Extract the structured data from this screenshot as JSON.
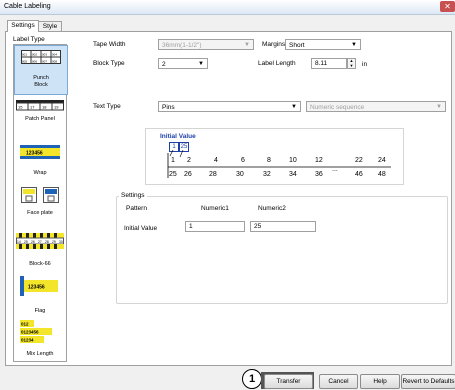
{
  "window": {
    "title": "Cable Labeling"
  },
  "tabs": [
    {
      "label": "Settings"
    },
    {
      "label": "Style"
    }
  ],
  "sidebar": {
    "title": "Label Type",
    "items": [
      {
        "label": "Punch Block",
        "icon": "punch-block-icon",
        "selected": true
      },
      {
        "label": "Patch Panel",
        "icon": "patch-panel-icon"
      },
      {
        "label": "Wrap",
        "icon": "wrap-icon"
      },
      {
        "label": "Face plate",
        "icon": "face-plate-icon"
      },
      {
        "label": "Block-66",
        "icon": "block-66-icon"
      },
      {
        "label": "Flag",
        "icon": "flag-icon"
      },
      {
        "label": "Mix Length",
        "icon": "mix-length-icon"
      }
    ],
    "icon_texts": {
      "punch": [
        "001",
        "002",
        "003",
        "004",
        "005",
        "006",
        "007",
        "008"
      ],
      "patch": [
        "15",
        "17",
        "18",
        "19"
      ],
      "wrap": "123456",
      "block66": [
        "14",
        "25",
        "26",
        "27",
        "28",
        "29",
        "30"
      ],
      "flag": "123456",
      "mix": [
        "012",
        "0123456",
        "01234"
      ]
    }
  },
  "form": {
    "tape_width": {
      "label": "Tape Width",
      "value": "36mm(1-1/2\")"
    },
    "margins": {
      "label": "Margins",
      "value": "Short"
    },
    "block_type": {
      "label": "Block Type",
      "value": "2"
    },
    "label_length": {
      "label": "Label Length",
      "value": "8.11",
      "unit": "in"
    },
    "text_type": {
      "label": "Text Type",
      "value": "Pins",
      "secondary": "Numeric sequence"
    }
  },
  "diagram": {
    "title": "Initial Value",
    "boxes": [
      "1",
      "25"
    ],
    "top_row": [
      "1",
      "2",
      "4",
      "6",
      "8",
      "10",
      "12",
      "22",
      "24"
    ],
    "bottom_row": [
      "25",
      "26",
      "28",
      "30",
      "32",
      "34",
      "36",
      "46",
      "48"
    ],
    "ellipsis": "..."
  },
  "settings_group": {
    "title": "Settings",
    "col_pattern": "Pattern",
    "col1": "Numeric1",
    "col2": "Numeric2",
    "row_label": "Initial Value",
    "value1": "1",
    "value2": "25"
  },
  "buttons": {
    "marker": "1",
    "transfer": "Transfer",
    "cancel": "Cancel",
    "help": "Help",
    "revert": "Revert to Defaults"
  },
  "colors": {
    "accent": "#1f3fa8",
    "label_yellow": "#f2e52a"
  }
}
